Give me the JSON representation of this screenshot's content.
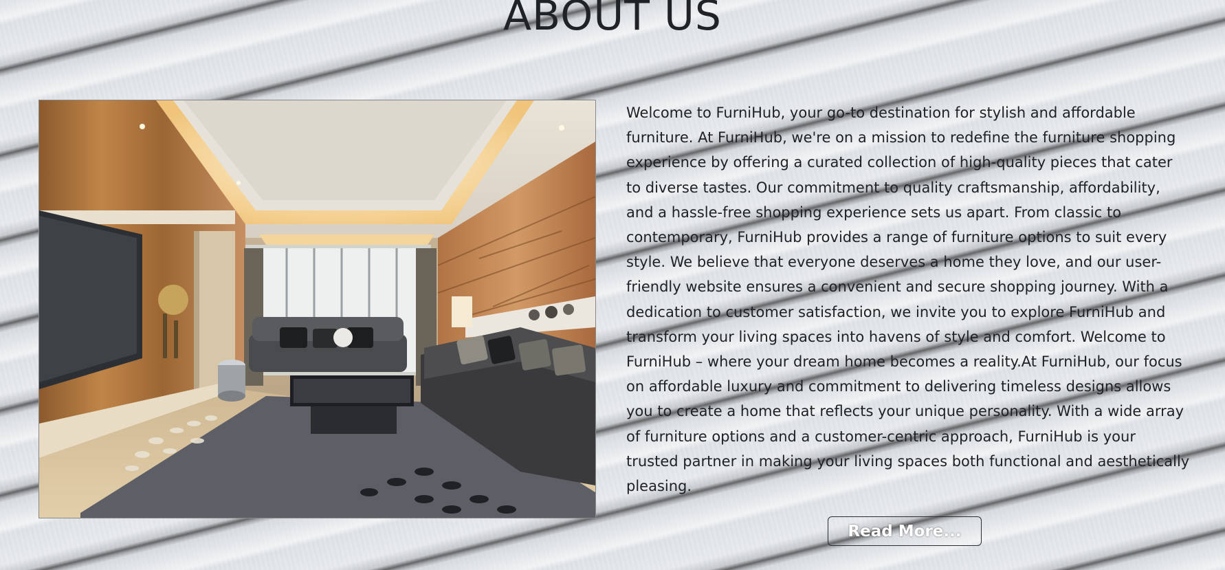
{
  "section": {
    "title": "ABOUT US",
    "image_alt": "Modern living room interior",
    "paragraph": "Welcome to FurniHub, your go-to destination for stylish and affordable furniture. At FurniHub, we're on a mission to redefine the furniture shopping experience by offering a curated collection of high-quality pieces that cater to diverse tastes. Our commitment to quality craftsmanship, affordability, and a hassle-free shopping experience sets us apart. From classic to contemporary, FurniHub provides a range of furniture options to suit every style. We believe that everyone deserves a home they love, and our user-friendly website ensures a convenient and secure shopping journey. With a dedication to customer satisfaction, we invite you to explore FurniHub and transform your living spaces into havens of style and comfort. Welcome to FurniHub – where your dream home becomes a reality.At FurniHub, our focus on affordable luxury and commitment to delivering timeless designs allows you to create a home that reflects your unique personality. With a wide array of furniture options and a customer-centric approach, FurniHub is your trusted partner in making your living spaces both functional and aesthetically pleasing.",
    "button_label": "Read More..."
  },
  "colors": {
    "text": "#1d2024",
    "title": "#1f2328",
    "button_text": "#ffffff",
    "button_border": "#2a2d30"
  }
}
